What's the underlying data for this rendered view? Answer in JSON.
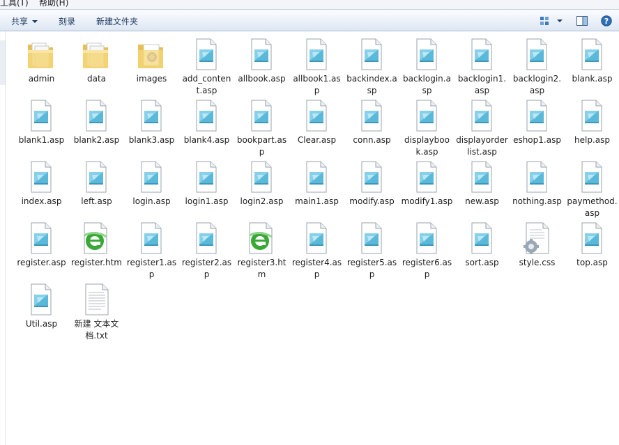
{
  "menubar": {
    "tools": "工具(T)",
    "help": "帮助(H)"
  },
  "commandbar": {
    "share": "共享",
    "burn": "刻录",
    "new_folder": "新建文件夹"
  },
  "colors": {
    "folder": "#f5d77a",
    "doc_blue": "#5ab9d9",
    "ie_green": "#3aa837"
  },
  "files": [
    {
      "name": "admin",
      "type": "folder"
    },
    {
      "name": "data",
      "type": "folder"
    },
    {
      "name": "images",
      "type": "folder-image"
    },
    {
      "name": "add_content.asp",
      "type": "asp"
    },
    {
      "name": "allbook.asp",
      "type": "asp"
    },
    {
      "name": "allbook1.asp",
      "type": "asp"
    },
    {
      "name": "backindex.asp",
      "type": "asp"
    },
    {
      "name": "backlogin.asp",
      "type": "asp"
    },
    {
      "name": "backlogin1.asp",
      "type": "asp"
    },
    {
      "name": "backlogin2.asp",
      "type": "asp"
    },
    {
      "name": "blank.asp",
      "type": "asp"
    },
    {
      "name": "blank1.asp",
      "type": "asp"
    },
    {
      "name": "blank2.asp",
      "type": "asp"
    },
    {
      "name": "blank3.asp",
      "type": "asp"
    },
    {
      "name": "blank4.asp",
      "type": "asp"
    },
    {
      "name": "bookpart.asp",
      "type": "asp"
    },
    {
      "name": "Clear.asp",
      "type": "asp"
    },
    {
      "name": "conn.asp",
      "type": "asp"
    },
    {
      "name": "displaybook.asp",
      "type": "asp"
    },
    {
      "name": "displayorderlist.asp",
      "type": "asp"
    },
    {
      "name": "eshop1.asp",
      "type": "asp"
    },
    {
      "name": "help.asp",
      "type": "asp"
    },
    {
      "name": "index.asp",
      "type": "asp"
    },
    {
      "name": "left.asp",
      "type": "asp"
    },
    {
      "name": "login.asp",
      "type": "asp"
    },
    {
      "name": "login1.asp",
      "type": "asp"
    },
    {
      "name": "login2.asp",
      "type": "asp"
    },
    {
      "name": "main1.asp",
      "type": "asp"
    },
    {
      "name": "modify.asp",
      "type": "asp"
    },
    {
      "name": "modify1.asp",
      "type": "asp"
    },
    {
      "name": "new.asp",
      "type": "asp"
    },
    {
      "name": "nothing.asp",
      "type": "asp"
    },
    {
      "name": "paymethod.asp",
      "type": "asp"
    },
    {
      "name": "register.asp",
      "type": "asp"
    },
    {
      "name": "register.htm",
      "type": "htm"
    },
    {
      "name": "register1.asp",
      "type": "asp"
    },
    {
      "name": "register2.asp",
      "type": "asp"
    },
    {
      "name": "register3.htm",
      "type": "htm"
    },
    {
      "name": "register4.asp",
      "type": "asp"
    },
    {
      "name": "register5.asp",
      "type": "asp"
    },
    {
      "name": "register6.asp",
      "type": "asp"
    },
    {
      "name": "sort.asp",
      "type": "asp"
    },
    {
      "name": "style.css",
      "type": "css"
    },
    {
      "name": "top.asp",
      "type": "asp"
    },
    {
      "name": "Util.asp",
      "type": "asp"
    },
    {
      "name": "新建 文本文档.txt",
      "type": "txt"
    }
  ]
}
